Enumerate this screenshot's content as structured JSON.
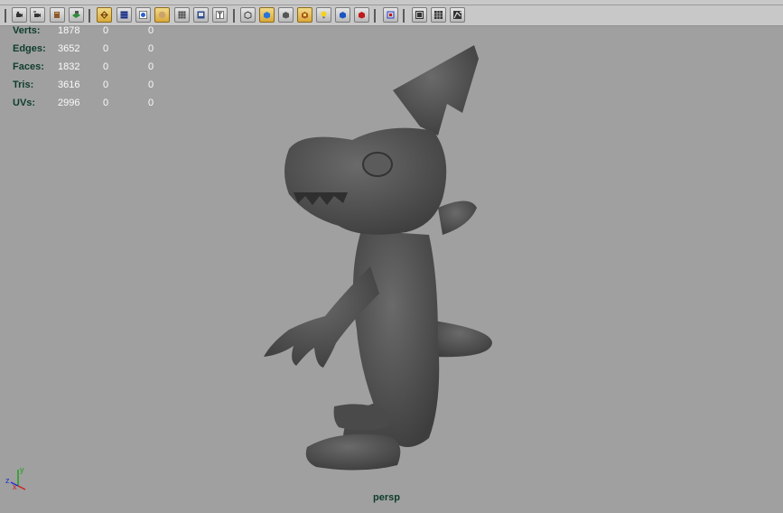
{
  "hud": {
    "rows": [
      {
        "label": "Verts:",
        "v1": "1878",
        "v2": "0",
        "v3": "0"
      },
      {
        "label": "Edges:",
        "v1": "3652",
        "v2": "0",
        "v3": "0"
      },
      {
        "label": "Faces:",
        "v1": "1832",
        "v2": "0",
        "v3": "0"
      },
      {
        "label": "Tris:",
        "v1": "3616",
        "v2": "0",
        "v3": "0"
      },
      {
        "label": "UVs:",
        "v1": "2996",
        "v2": "0",
        "v3": "0"
      }
    ]
  },
  "viewport": {
    "camera": "persp",
    "axis": {
      "x": "x",
      "y": "y",
      "z": "z"
    }
  },
  "colors": {
    "background": "#a0a0a0",
    "hud_label": "#0e3d2a",
    "hud_value": "#fafafa",
    "model": "#4f4f4f",
    "axis_x": "#d02020",
    "axis_y": "#20a020",
    "axis_z": "#2030d0"
  }
}
